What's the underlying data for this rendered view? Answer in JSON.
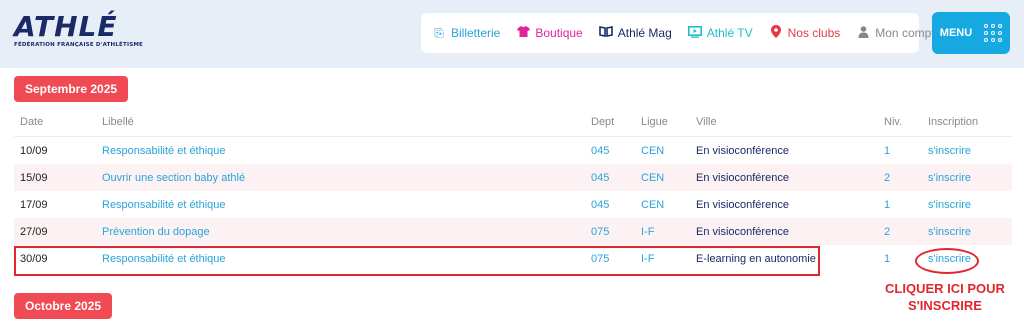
{
  "logo": {
    "wordmark": "ATHLÉ",
    "subtitle": "FÉDÉRATION FRANÇAISE D'ATHLÉTISME"
  },
  "nav": {
    "items": [
      {
        "label": "Billetterie",
        "icon": "ticket-icon",
        "color": "#2aa3d8"
      },
      {
        "label": "Boutique",
        "icon": "tshirt-icon",
        "color": "#e3239a"
      },
      {
        "label": "Athlé Mag",
        "icon": "book-icon",
        "color": "#1a2a66"
      },
      {
        "label": "Athlé TV",
        "icon": "tv-play-icon",
        "color": "#1fbfc8"
      },
      {
        "label": "Nos clubs",
        "icon": "location-pin-icon",
        "color": "#e63946"
      },
      {
        "label": "Mon compte",
        "icon": "user-icon",
        "color": "#888888"
      }
    ],
    "menu_label": "MENU"
  },
  "months": {
    "september": "Septembre 2025",
    "october": "Octobre 2025"
  },
  "table": {
    "headers": {
      "date": "Date",
      "libelle": "Libellé",
      "dept": "Dept",
      "ligue": "Ligue",
      "ville": "Ville",
      "niv": "Niv.",
      "inscription": "Inscription"
    },
    "rows": [
      {
        "date": "10/09",
        "libelle": "Responsabilité et éthique",
        "dept": "045",
        "ligue": "CEN",
        "ville": "En visioconférence",
        "niv": "1",
        "inscription": "s'inscrire"
      },
      {
        "date": "15/09",
        "libelle": "Ouvrir une section baby athlé",
        "dept": "045",
        "ligue": "CEN",
        "ville": "En visioconférence",
        "niv": "2",
        "inscription": "s'inscrire"
      },
      {
        "date": "17/09",
        "libelle": "Responsabilité et éthique",
        "dept": "045",
        "ligue": "CEN",
        "ville": "En visioconférence",
        "niv": "1",
        "inscription": "s'inscrire"
      },
      {
        "date": "27/09",
        "libelle": "Prévention du dopage",
        "dept": "075",
        "ligue": "I-F",
        "ville": "En visioconférence",
        "niv": "2",
        "inscription": "s'inscrire"
      },
      {
        "date": "30/09",
        "libelle": "Responsabilité et éthique",
        "dept": "075",
        "ligue": "I-F",
        "ville": "E-learning en autonomie",
        "niv": "1",
        "inscription": "s'inscrire"
      }
    ]
  },
  "callout": {
    "line1": "CLIQUER ICI POUR",
    "line2": "S'INSCRIRE"
  },
  "colors": {
    "accent": "#16a9e1",
    "badge": "#f04a54",
    "annotation": "#e2262f",
    "link": "#2aa3d8",
    "navy": "#1a2a66"
  }
}
